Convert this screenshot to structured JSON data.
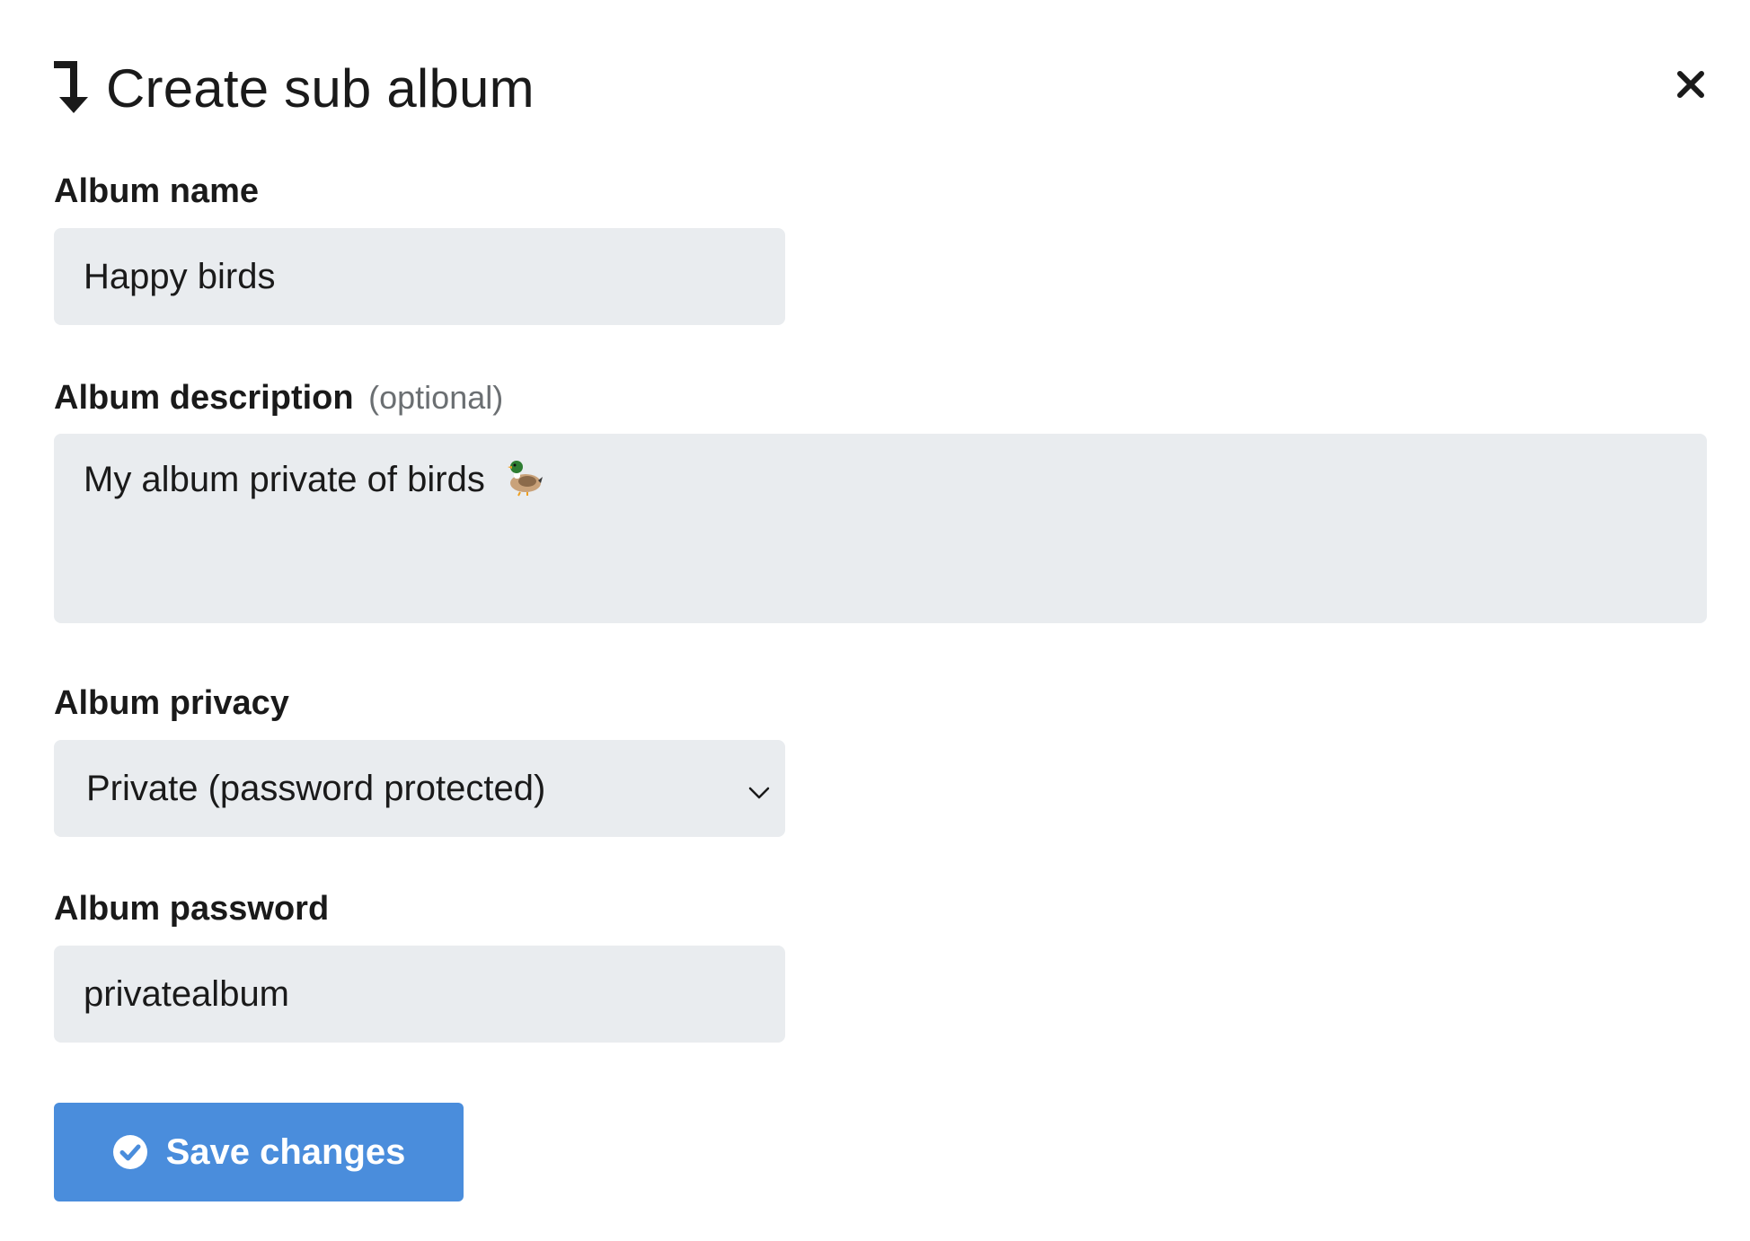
{
  "dialog": {
    "title": "Create sub album",
    "title_icon": "arrow-down-turn-icon",
    "close_icon": "close-icon"
  },
  "form": {
    "name": {
      "label": "Album name",
      "value": "Happy birds"
    },
    "description": {
      "label": "Album description",
      "optional_hint": "(optional)",
      "value": "My album private of birds",
      "emoji_icon": "duck-emoji-icon"
    },
    "privacy": {
      "label": "Album privacy",
      "selected": "Private (password protected)",
      "chevron_icon": "chevron-down-icon"
    },
    "password": {
      "label": "Album password",
      "value": "privatealbum"
    }
  },
  "actions": {
    "save_label": "Save changes",
    "save_icon": "check-circle-icon",
    "save_color": "#4a8ddc"
  },
  "colors": {
    "field_bg": "#e9ecef",
    "text": "#1a1a1a",
    "muted": "#6b6f72"
  }
}
